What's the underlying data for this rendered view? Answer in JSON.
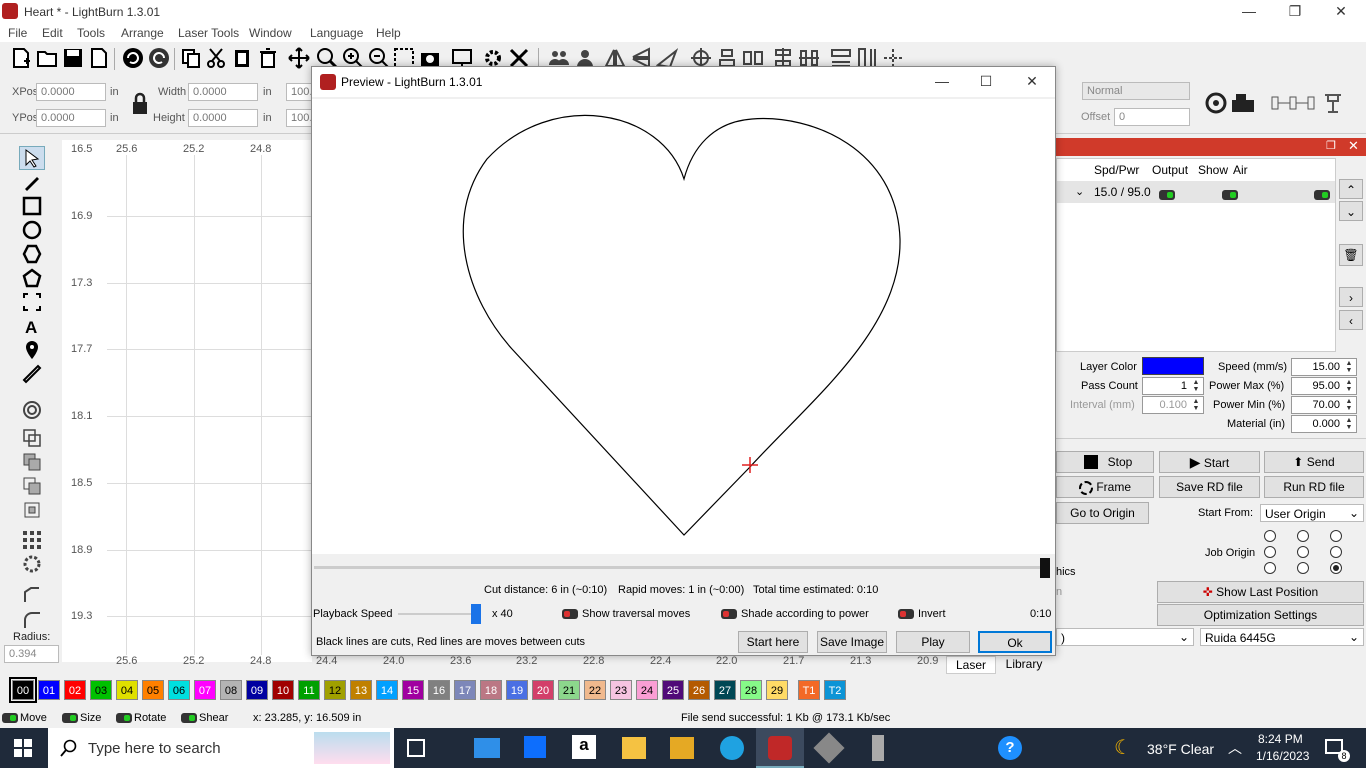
{
  "window": {
    "title": "Heart * - LightBurn 1.3.01"
  },
  "menu": [
    "File",
    "Edit",
    "Tools",
    "Arrange",
    "Laser Tools",
    "Window",
    "Language",
    "Help"
  ],
  "posbar": {
    "xpos_label": "XPos",
    "xpos_value": "0.0000",
    "ypos_label": "YPos",
    "ypos_value": "0.0000",
    "width_label": "Width",
    "width_value": "0.0000",
    "height_label": "Height",
    "height_value": "0.0000",
    "unit": "in",
    "trunc1": "100.",
    "trunc2": "100.",
    "mode_value": "Normal",
    "offset_label": "Offset",
    "offset_value": "0"
  },
  "ruler": {
    "top": [
      "25.6",
      "25.2",
      "24.8"
    ],
    "left": [
      "16.5",
      "16.9",
      "17.3",
      "17.7",
      "18.1",
      "18.5",
      "18.9",
      "19.3"
    ],
    "bottom": [
      "25.6",
      "25.2",
      "24.8",
      "24.4",
      "24.0",
      "23.6",
      "23.2",
      "22.8",
      "22.4",
      "22.0",
      "21.7",
      "21.3",
      "20.9"
    ]
  },
  "radius": {
    "label": "Radius:",
    "value": "0.394"
  },
  "preview": {
    "title": "Preview - LightBurn 1.3.01",
    "stats": {
      "cut": "Cut distance: 6 in (~0:10)",
      "rapid": "Rapid moves: 1 in (~0:00)",
      "total": "Total time estimated: 0:10"
    },
    "playback_label": "Playback Speed",
    "speed_mult": "x 40",
    "show_traversal": "Show traversal moves",
    "shade_power": "Shade according to power",
    "invert": "Invert",
    "time": "0:10",
    "legend": "Black lines are cuts, Red lines are moves between cuts",
    "buttons": {
      "start_here": "Start here",
      "save_image": "Save Image",
      "play": "Play",
      "ok": "Ok"
    }
  },
  "cuts": {
    "headers": [
      "Spd/Pwr",
      "Output",
      "Show",
      "Air"
    ],
    "row": {
      "spdpwr": "15.0 / 95.0"
    }
  },
  "layer": {
    "color_label": "Layer Color",
    "color": "#0000ff",
    "pass_label": "Pass Count",
    "pass_value": "1",
    "interval_label": "Interval (mm)",
    "interval_value": "0.100",
    "speed_label": "Speed (mm/s)",
    "speed_value": "15.00",
    "pmax_label": "Power Max (%)",
    "pmax_value": "95.00",
    "pmin_label": "Power Min (%)",
    "pmin_value": "70.00",
    "material_label": "Material (in)",
    "material_value": "0.000"
  },
  "laser": {
    "stop": "Stop",
    "start": "Start",
    "send": "Send",
    "frame": "Frame",
    "save_rd": "Save RD file",
    "run_rd": "Run RD file",
    "goto_origin": "Go to Origin",
    "start_from_label": "Start From:",
    "start_from_value": "User Origin",
    "job_origin_label": "Job Origin",
    "hics": "hics",
    "n_frag": "n",
    "show_last": "Show Last Position",
    "optim": "Optimization Settings",
    "port_frag": ")",
    "device": "Ruida 6445G"
  },
  "tabs": {
    "laser": "Laser",
    "library": "Library"
  },
  "palette": [
    "00",
    "01",
    "02",
    "03",
    "04",
    "05",
    "06",
    "07",
    "08",
    "09",
    "10",
    "11",
    "12",
    "13",
    "14",
    "15",
    "16",
    "17",
    "18",
    "19",
    "20",
    "21",
    "22",
    "23",
    "24",
    "25",
    "26",
    "27",
    "28",
    "29",
    "T1",
    "T2"
  ],
  "palette_colors": [
    "#000000",
    "#0000ff",
    "#ff0000",
    "#00c000",
    "#e0e000",
    "#ff8000",
    "#00e0e0",
    "#ff00ff",
    "#b4b4b4",
    "#0000a0",
    "#a00000",
    "#00a000",
    "#a0a000",
    "#c08000",
    "#00a0ff",
    "#a000a0",
    "#808080",
    "#7d87b9",
    "#bb7784",
    "#4a6fe3",
    "#d33f6a",
    "#8cd78c",
    "#f0b98d",
    "#f6c4e1",
    "#fa9ed4",
    "#500a78",
    "#b45a00",
    "#004754",
    "#86fa88",
    "#ffdb66",
    "#f36926",
    "#0c94d6"
  ],
  "status": {
    "move": "Move",
    "size": "Size",
    "rotate": "Rotate",
    "shear": "Shear",
    "coords": "x: 23.285, y: 16.509 in",
    "msg": "File send successful: 1 Kb @ 173.1 Kb/sec"
  },
  "taskbar": {
    "search": "Type here to search",
    "weather": "38°F  Clear",
    "time": "8:24 PM",
    "date": "1/16/2023",
    "notif": "8"
  }
}
